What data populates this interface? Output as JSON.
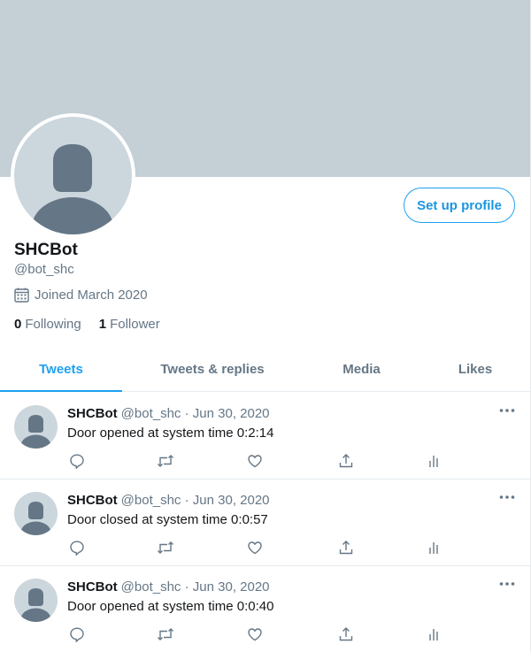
{
  "profile": {
    "display_name": "SHCBot",
    "handle": "@bot_shc",
    "joined": "Joined March 2020",
    "following_count": "0",
    "following_label": "Following",
    "followers_count": "1",
    "followers_label": "Follower",
    "setup_button": "Set up profile",
    "banner_color": "#c4cfd6",
    "accent_color": "#1da1f2"
  },
  "tabs": [
    {
      "label": "Tweets",
      "active": true
    },
    {
      "label": "Tweets & replies",
      "active": false
    },
    {
      "label": "Media",
      "active": false
    },
    {
      "label": "Likes",
      "active": false
    }
  ],
  "tweets": [
    {
      "name": "SHCBot",
      "handle": "@bot_shc",
      "sep": "·",
      "date": "Jun 30, 2020",
      "text": "Door opened at system time 0:2:14"
    },
    {
      "name": "SHCBot",
      "handle": "@bot_shc",
      "sep": "·",
      "date": "Jun 30, 2020",
      "text": "Door closed at system time 0:0:57"
    },
    {
      "name": "SHCBot",
      "handle": "@bot_shc",
      "sep": "·",
      "date": "Jun 30, 2020",
      "text": "Door opened at system time 0:0:40"
    }
  ],
  "tweet_actions": [
    "reply-icon",
    "retweet-icon",
    "like-icon",
    "share-icon",
    "analytics-icon"
  ]
}
